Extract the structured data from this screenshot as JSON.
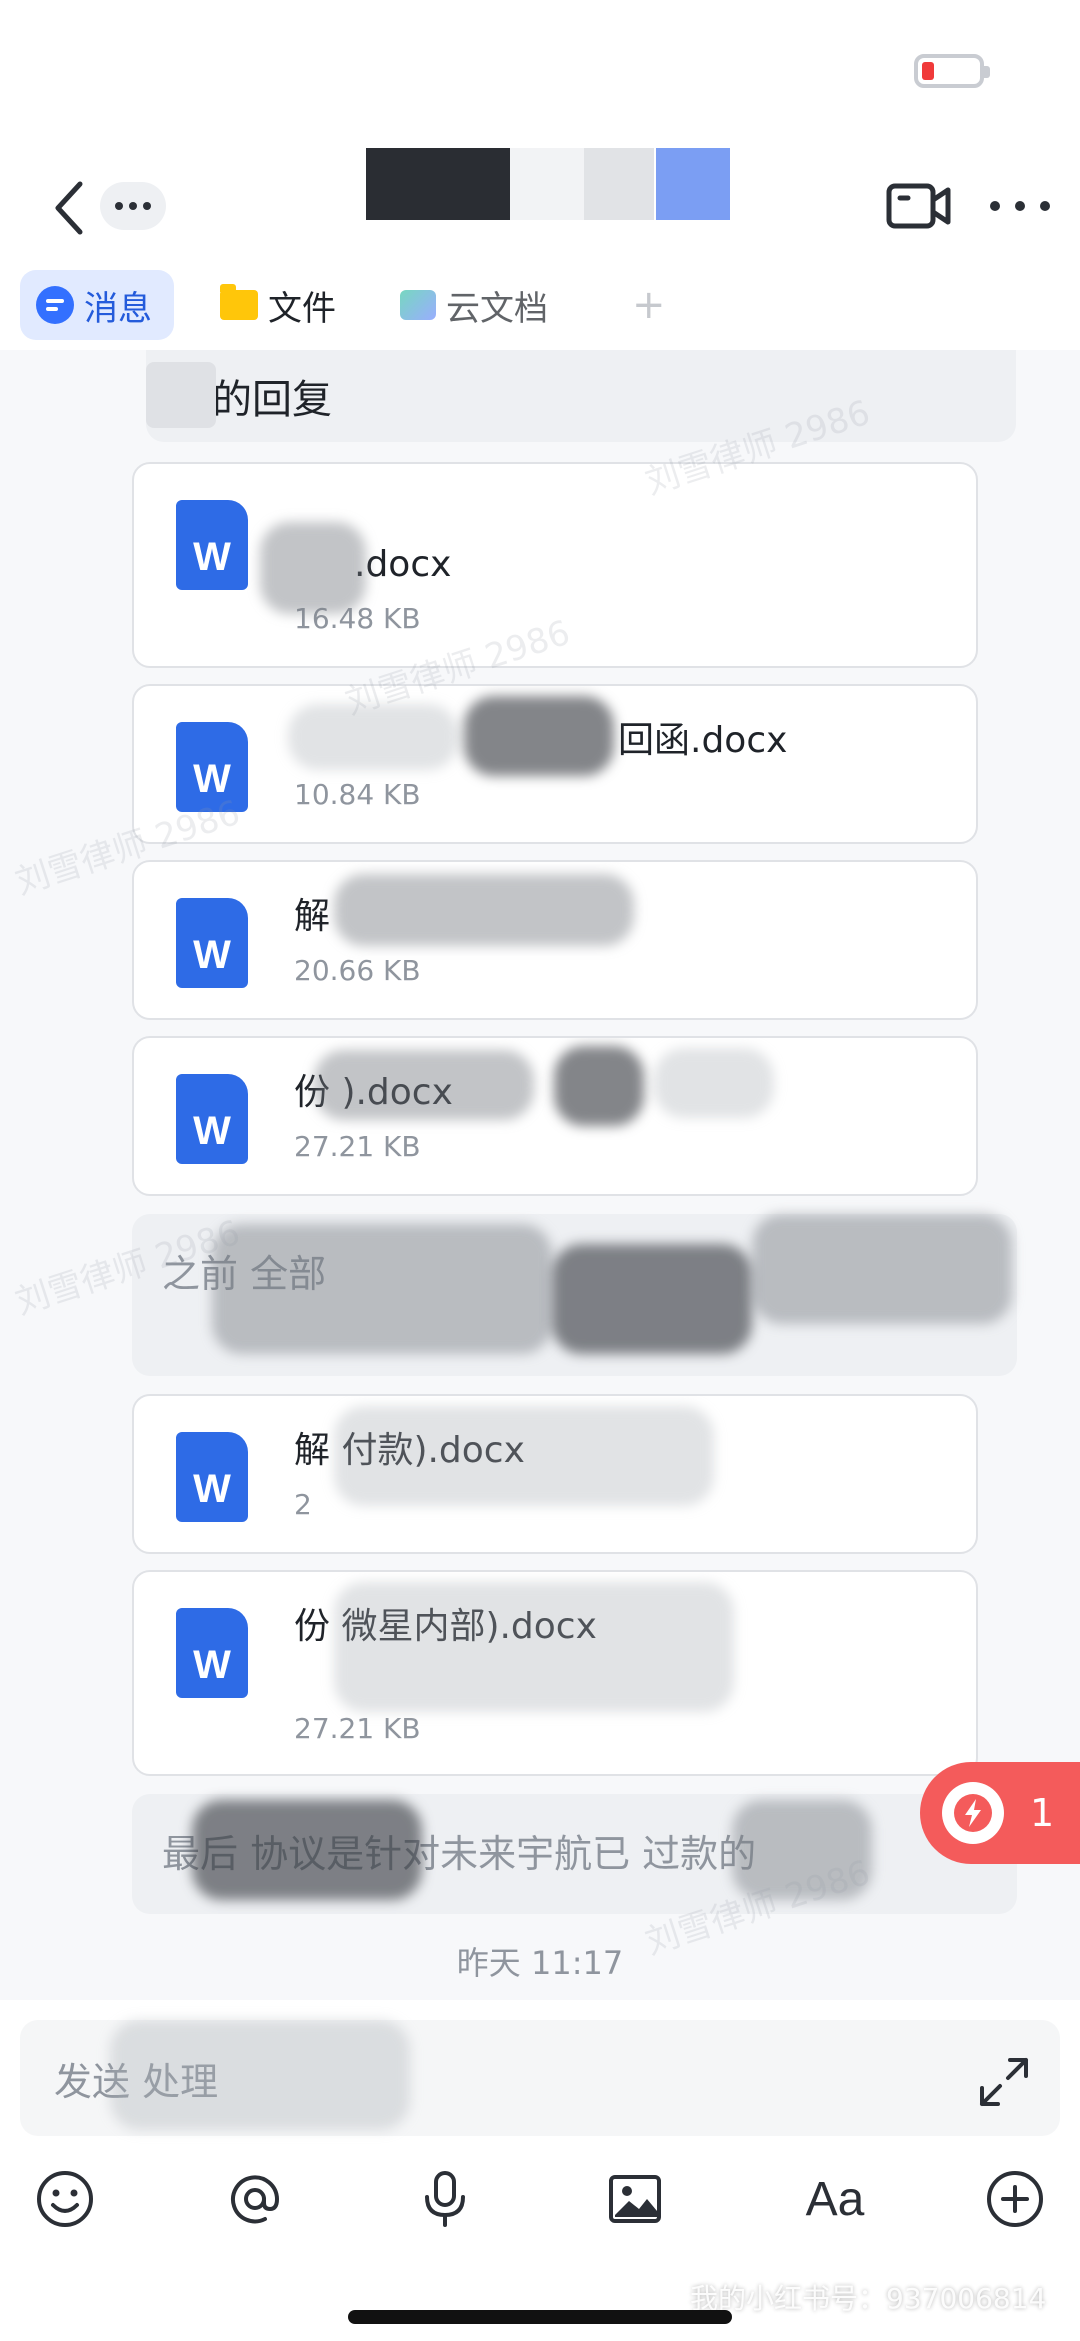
{
  "tabs": [
    {
      "label": "消息",
      "icon": "chat-icon",
      "active": true
    },
    {
      "label": "文件",
      "icon": "folder-icon",
      "active": false
    },
    {
      "label": "云文档",
      "icon": "cloud-doc-icon",
      "active": false
    }
  ],
  "tab_add_label": "+",
  "reply_quote": {
    "text": "的回复"
  },
  "files": [
    {
      "name": ".docx",
      "size": "16.48 KB"
    },
    {
      "name": "回函.docx",
      "size": "10.84 KB"
    },
    {
      "name": "解",
      "size": "20.66 KB"
    },
    {
      "name": "份 ).docx",
      "size": "27.21 KB"
    },
    {
      "name": "解 付款).docx",
      "size": "2"
    },
    {
      "name": "份 微星内部).docx",
      "size": "27.21 KB"
    }
  ],
  "text_messages": [
    {
      "text": "之前 全部"
    },
    {
      "text": "最后 协议是针对未来宇航已 过款的"
    }
  ],
  "timestamp": "昨天 11:17",
  "input_placeholder": "发送 处理",
  "float_badge_count": "1",
  "toolbar": {
    "text_format_label": "Aa"
  },
  "watermark": "刘雪律师 2986",
  "bottom_watermark": "我的小红书号：937006814",
  "colors": {
    "accent": "#3370ff",
    "badge": "#f45b5b",
    "word_icon": "#2e6be6",
    "battery_low": "#f03a3a"
  }
}
